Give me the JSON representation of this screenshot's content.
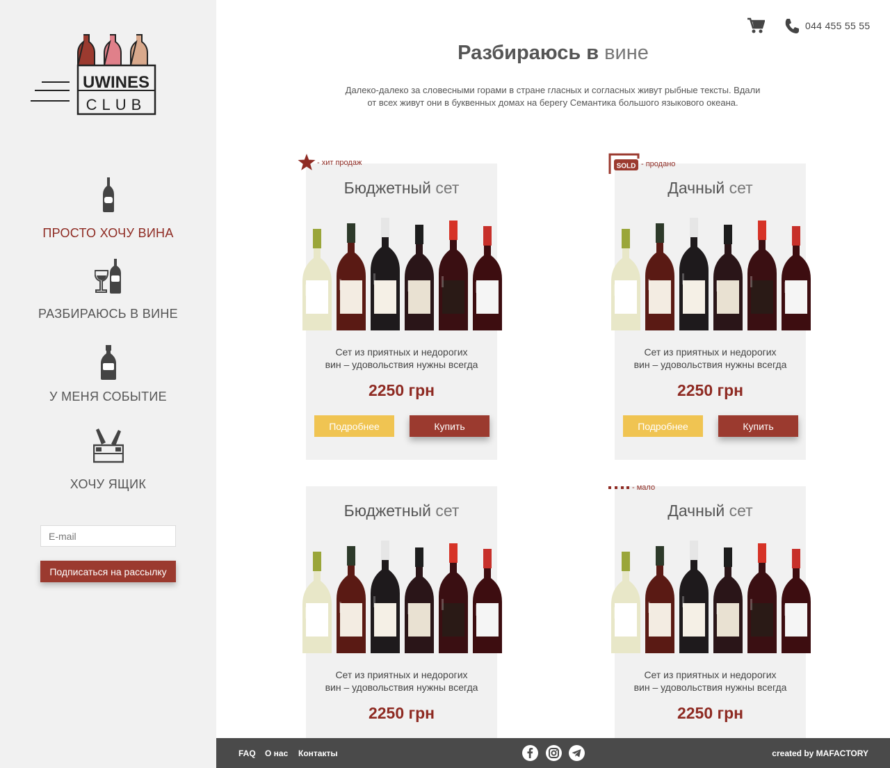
{
  "brand": {
    "line1": "UWINES",
    "line2": "CLUB"
  },
  "header": {
    "phone": "044 455 55 55"
  },
  "nav": [
    {
      "label": "ПРОСТО ХОЧУ ВИНА",
      "icon": "wine-bottle-icon",
      "active": true
    },
    {
      "label": "РАЗБИРАЮСЬ В ВИНЕ",
      "icon": "wine-glass-bottle-icon",
      "active": false
    },
    {
      "label": "У МЕНЯ СОБЫТИЕ",
      "icon": "champagne-bottle-icon",
      "active": false
    },
    {
      "label": "ХОЧУ ЯЩИК",
      "icon": "wine-crate-icon",
      "active": false
    }
  ],
  "subscribe": {
    "placeholder": "E-mail",
    "button": "Подписаться на рассылку"
  },
  "main": {
    "title_bold": "Разбираюсь в",
    "title_light": "вине",
    "intro": "Далеко-далеко за словесными горами в стране гласных и согласных живут рыбные тексты. Вдали от всех живут они в буквенных домах на берегу Семантика большого языкового океана."
  },
  "cards": [
    {
      "title_bold": "Бюджетный",
      "title_light": "сет",
      "desc_line1": "Сет из приятных и недорогих",
      "desc_line2": "вин – удовольствия нужны всегда",
      "price": "2250 грн",
      "more": "Подробнее",
      "buy": "Купить",
      "badge": "- хит продаж",
      "badge_icon": "star-icon"
    },
    {
      "title_bold": "Дачный",
      "title_light": "сет",
      "desc_line1": "Сет из приятных и недорогих",
      "desc_line2": "вин – удовольствия нужны всегда",
      "price": "2250 грн",
      "more": "Подробнее",
      "buy": "Купить",
      "badge": "- продано",
      "badge_icon": "sold-icon",
      "badge_icon_text": "SOLD"
    },
    {
      "title_bold": "Бюджетный",
      "title_light": "сет",
      "desc_line1": "Сет из приятных и недорогих",
      "desc_line2": "вин – удовольствия нужны всегда",
      "price": "2250 грн"
    },
    {
      "title_bold": "Дачный",
      "title_light": "сет",
      "desc_line1": "Сет из приятных и недорогих",
      "desc_line2": "вин – удовольствия нужны всегда",
      "price": "2250 грн",
      "badge": "- мало",
      "badge_icon": "low-stock-icon"
    }
  ],
  "footer": {
    "links": [
      "FAQ",
      "О нас",
      "Контакты"
    ],
    "social": [
      "facebook-icon",
      "instagram-icon",
      "telegram-icon"
    ],
    "credit": "created by MAFACTORY"
  },
  "colors": {
    "accent": "#9b3a2f",
    "accent_text": "#8e2a22",
    "secondary_button": "#f0c452",
    "sidebar_bg": "#f1f1f1",
    "footer_bg": "#4a4a4a"
  }
}
